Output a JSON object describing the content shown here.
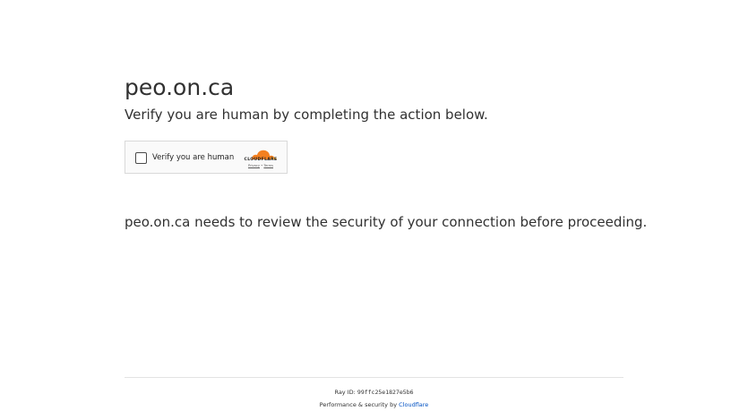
{
  "site_title": "peo.on.ca",
  "subtitle": "Verify you are human by completing the action below.",
  "widget": {
    "checkbox_label": "Verify you are human",
    "brand_wordmark": "CLOUDFLARE",
    "privacy_link": "Privacy",
    "separator": "•",
    "terms_link": "Terms",
    "brand_color": "#f38020"
  },
  "message": "peo.on.ca needs to review the security of your connection before proceeding.",
  "footer": {
    "ray_prefix": "Ray ID: ",
    "ray_id": "99ffc25e1827e5b6",
    "perf_prefix": "Performance & security by ",
    "perf_link": "Cloudflare",
    "link_color": "#0051c3"
  }
}
